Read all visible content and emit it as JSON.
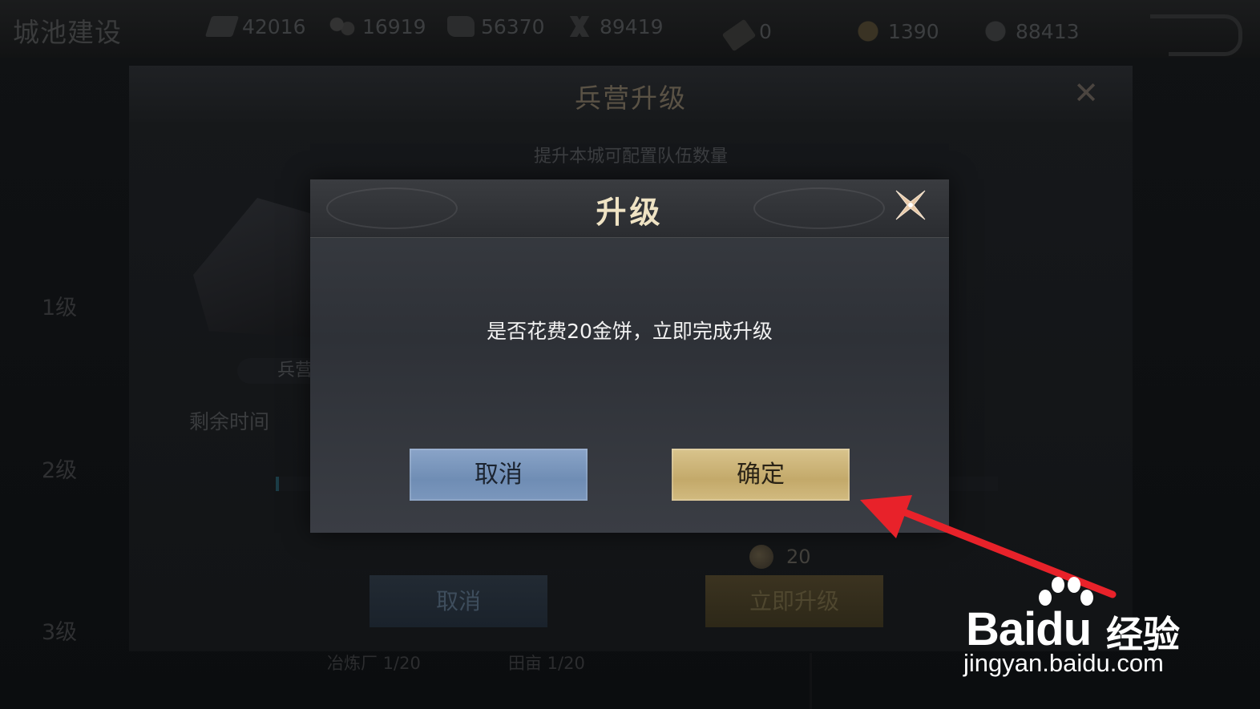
{
  "topbar": {
    "title": "城池建设",
    "resources": [
      {
        "icon": "wood-icon",
        "value": "42016"
      },
      {
        "icon": "iron-icon",
        "value": "16919"
      },
      {
        "icon": "stone-icon",
        "value": "56370"
      },
      {
        "icon": "grain-icon",
        "value": "89419"
      },
      {
        "icon": "token-icon",
        "value": "0"
      },
      {
        "icon": "copper-coin-icon",
        "value": "1390"
      },
      {
        "icon": "gold-coin-icon",
        "value": "88413"
      }
    ]
  },
  "levels": [
    "1级",
    "2级",
    "3级"
  ],
  "barracks_dialog": {
    "title": "兵营升级",
    "subtitle": "提升本城可配置队伍数量",
    "building_name": "兵营",
    "remaining_label": "剩余时间",
    "cost": "20",
    "cancel_label": "取消",
    "upgrade_label": "立即升级"
  },
  "footer": {
    "items": [
      "冶炼厂 1/20",
      "田亩 1/20"
    ]
  },
  "confirm_dialog": {
    "title": "升级",
    "message": "是否花费20金饼，立即完成升级",
    "cancel_label": "取消",
    "ok_label": "确定"
  },
  "colors": {
    "ok_button": "#c9b073",
    "cancel_button": "#7a96bc",
    "arrow": "#e8222a"
  },
  "watermark": {
    "brand": "Bai",
    "brand_du": "du",
    "cn": "经验",
    "url": "jingyan.baidu.com"
  }
}
